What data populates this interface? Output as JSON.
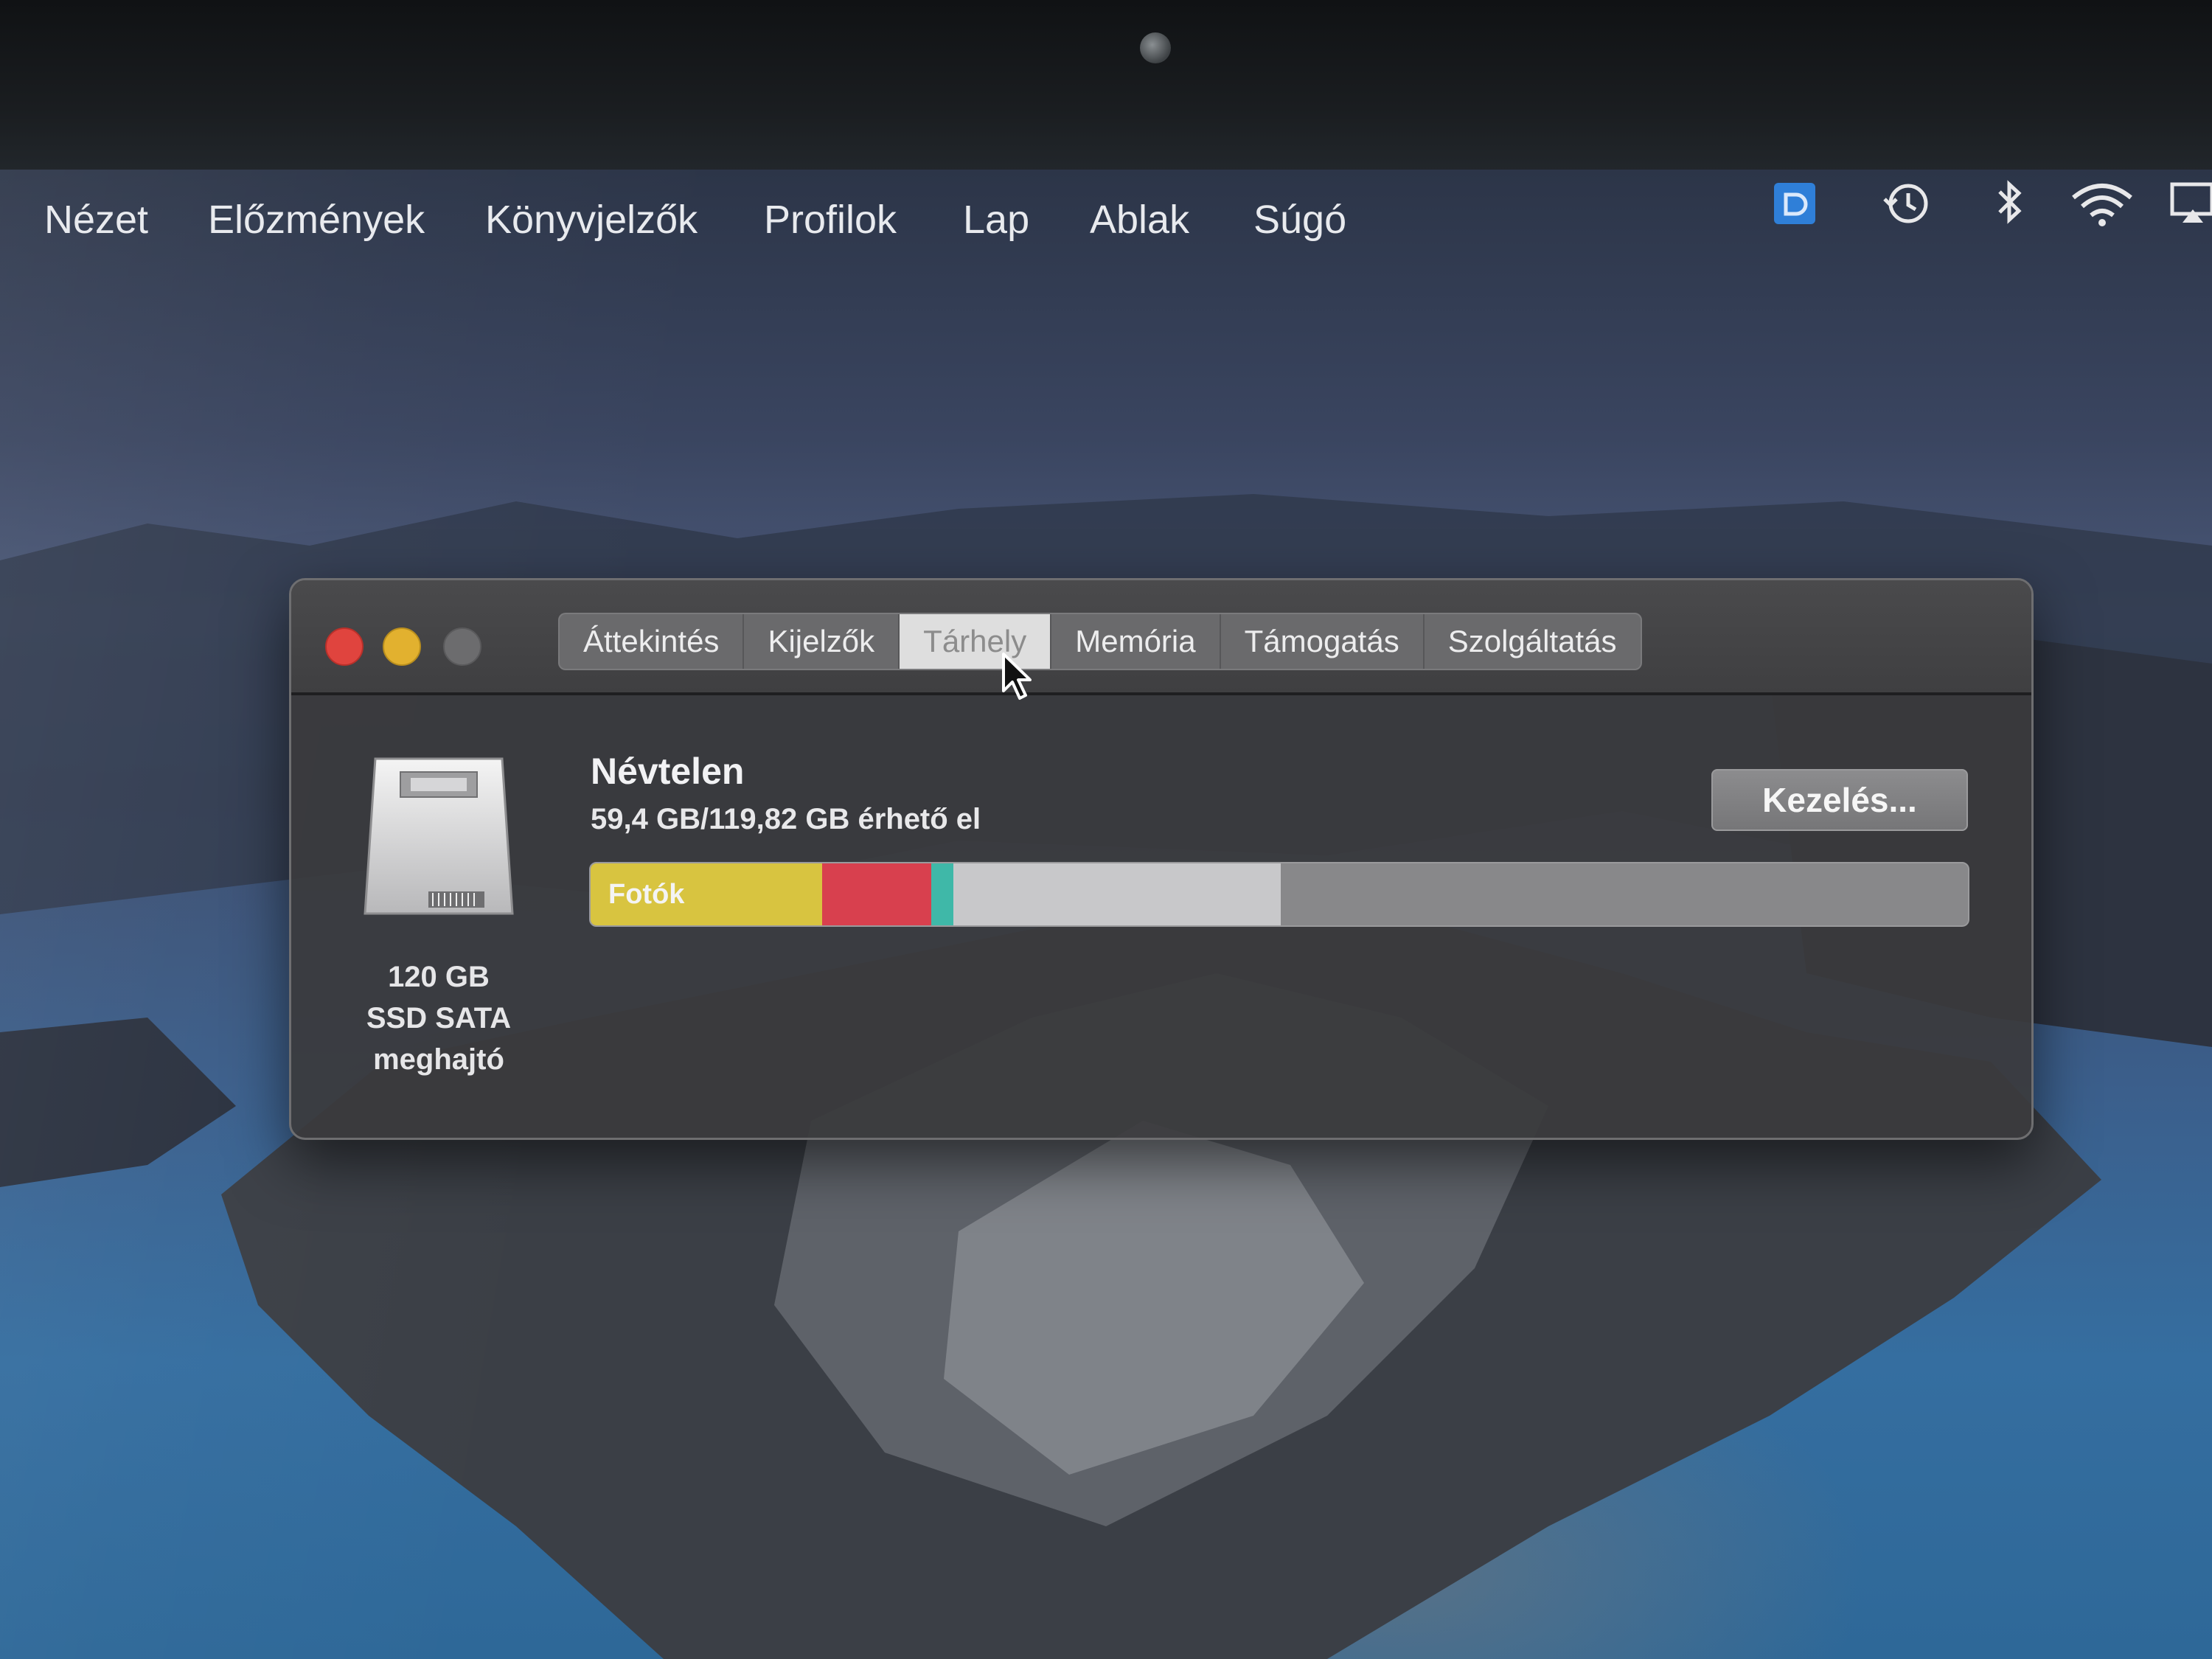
{
  "menubar": {
    "items": [
      "Nézet",
      "Előzmények",
      "Könyvjelzők",
      "Profilok",
      "Lap",
      "Ablak",
      "Súgó"
    ],
    "status_icons": [
      "app-badge-icon",
      "time-machine-icon",
      "bluetooth-icon",
      "wifi-icon",
      "airplay-icon"
    ]
  },
  "window": {
    "tabs": [
      {
        "label": "Áttekintés",
        "active": false
      },
      {
        "label": "Kijelzők",
        "active": false
      },
      {
        "label": "Tárhely",
        "active": true
      },
      {
        "label": "Memória",
        "active": false
      },
      {
        "label": "Támogatás",
        "active": false
      },
      {
        "label": "Szolgáltatás",
        "active": false
      }
    ],
    "disk": {
      "caption_line1": "120 GB",
      "caption_line2": "SSD SATA",
      "caption_line3": "meghajtó"
    },
    "volume": {
      "name": "Névtelen",
      "availability": "59,4 GB/119,82 GB érhető el"
    },
    "manage_button": "Kezelés...",
    "storage_bar": {
      "first_segment_label": "Fotók",
      "segments": [
        {
          "name": "Fotók",
          "fraction": 0.17,
          "color": "#d8c440"
        },
        {
          "name": "",
          "fraction": 0.08,
          "color": "#d8404e"
        },
        {
          "name": "",
          "fraction": 0.016,
          "color": "#3fb8a8"
        },
        {
          "name": "",
          "fraction": 0.24,
          "color": "#c8c8ca"
        },
        {
          "name": "",
          "fraction": 0.504,
          "color": "#88888a"
        }
      ]
    }
  },
  "colors": {
    "close": "#e0443e",
    "minimize": "#e2b12f",
    "zoom_disabled": "#6c6c6e"
  }
}
